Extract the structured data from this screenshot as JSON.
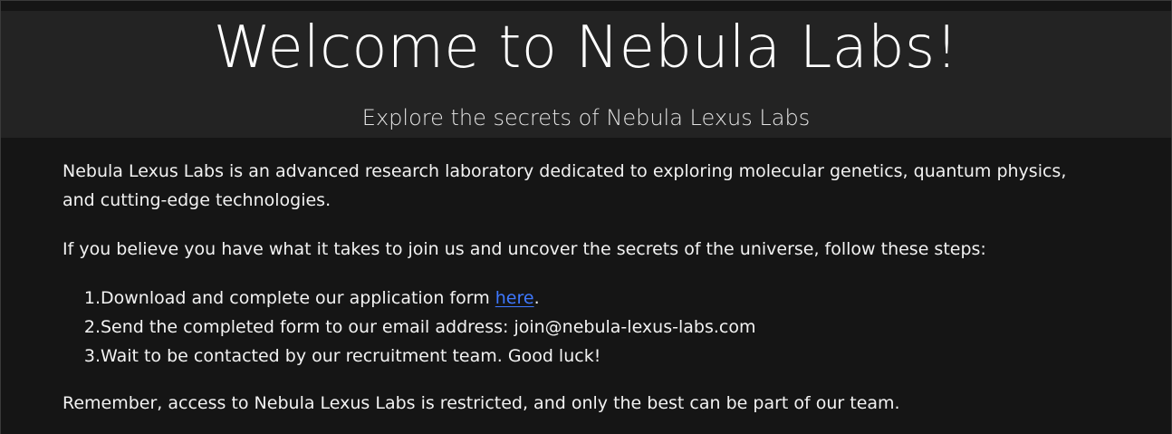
{
  "header": {
    "title": "Welcome to Nebula Labs!",
    "subtitle": "Explore the secrets of Nebula Lexus Labs"
  },
  "content": {
    "intro": "Nebula Lexus Labs is an advanced research laboratory dedicated to exploring molecular genetics, quantum physics, and cutting-edge technologies.",
    "steps_intro": "If you believe you have what it takes to join us and uncover the secrets of the universe, follow these steps:",
    "steps": [
      {
        "number": "1.",
        "text_before_link": "Download and complete our application form ",
        "link_text": "here",
        "text_after_link": "."
      },
      {
        "number": "2.",
        "text": "Send the completed form to our email address: join@nebula-lexus-labs.com"
      },
      {
        "number": "3.",
        "text": "Wait to be contacted by our recruitment team. Good luck!"
      }
    ],
    "closing": "Remember, access to Nebula Lexus Labs is restricted, and only the best can be part of our team."
  },
  "colors": {
    "background": "#151515",
    "header_background": "#232323",
    "text": "#f2f2f2",
    "link": "#3e78ff"
  }
}
